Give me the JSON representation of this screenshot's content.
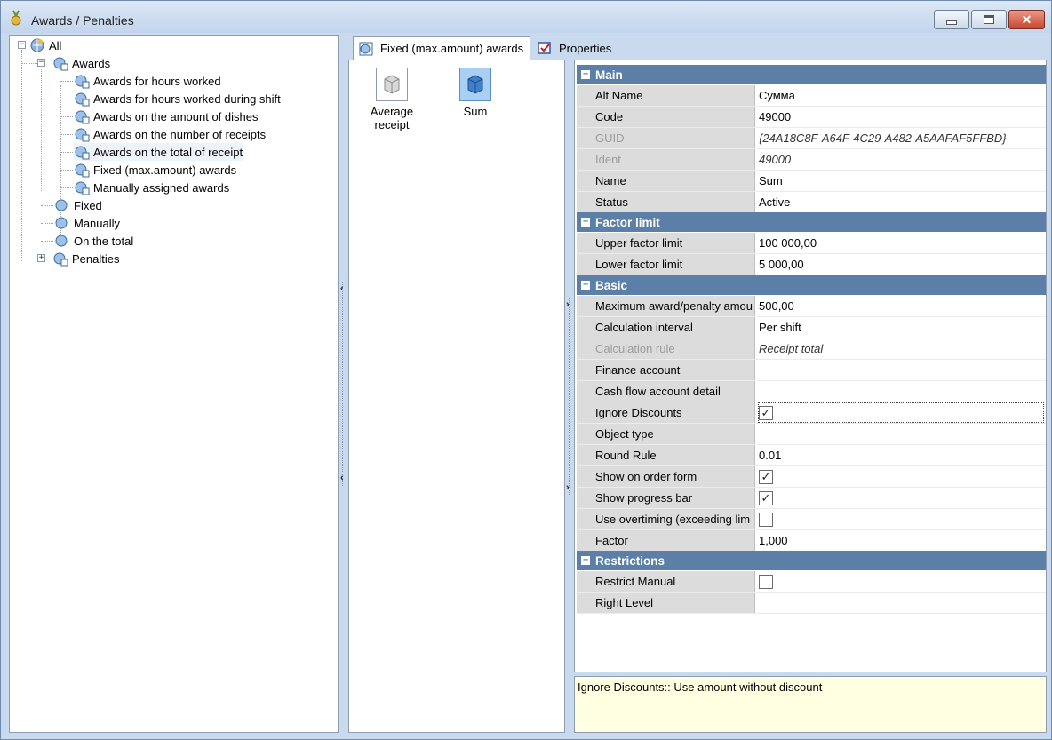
{
  "window": {
    "title": "Awards / Penalties"
  },
  "tree": {
    "root": "All",
    "awards": "Awards",
    "children": [
      "Awards for hours worked",
      "Awards for hours worked during shift",
      "Awards on the amount of dishes",
      "Awards on the number of receipts",
      "Awards on the total of receipt",
      "Fixed (max.amount) awards",
      "Manually assigned awards"
    ],
    "siblings": [
      "Fixed",
      "Manually",
      "On the total"
    ],
    "penalties": "Penalties"
  },
  "tabs": {
    "active": "Fixed (max.amount) awards",
    "properties": "Properties"
  },
  "items": [
    {
      "label": "Average receipt",
      "selected": false
    },
    {
      "label": "Sum",
      "selected": true
    }
  ],
  "properties": {
    "main": {
      "title": "Main",
      "rows": [
        {
          "name": "Alt Name",
          "value": "Сумма"
        },
        {
          "name": "Code",
          "value": "49000"
        },
        {
          "name": "GUID",
          "value": "{24A18C8F-A64F-4C29-A482-A5AAFAF5FFBD}"
        },
        {
          "name": "Ident",
          "value": "49000"
        },
        {
          "name": "Name",
          "value": "Sum"
        },
        {
          "name": "Status",
          "value": "Active"
        }
      ]
    },
    "factor": {
      "title": "Factor limit",
      "rows": [
        {
          "name": "Upper factor limit",
          "value": "100 000,00"
        },
        {
          "name": "Lower factor limit",
          "value": "5 000,00"
        }
      ]
    },
    "basic": {
      "title": "Basic",
      "rows": [
        {
          "name": "Maximum award/penalty amou",
          "value": "500,00"
        },
        {
          "name": "Calculation interval",
          "value": "Per shift"
        },
        {
          "name": "Calculation rule",
          "value": "Receipt total"
        },
        {
          "name": "Finance account",
          "value": ""
        },
        {
          "name": "Cash flow account detail",
          "value": ""
        },
        {
          "name": "Ignore Discounts",
          "value": "checked"
        },
        {
          "name": "Object type",
          "value": ""
        },
        {
          "name": "Round Rule",
          "value": "0.01"
        },
        {
          "name": "Show on order form",
          "value": "checked"
        },
        {
          "name": "Show progress bar",
          "value": "checked"
        },
        {
          "name": "Use overtiming (exceeding lim",
          "value": "unchecked"
        },
        {
          "name": "Factor",
          "value": "1,000"
        }
      ]
    },
    "restrictions": {
      "title": "Restrictions",
      "rows": [
        {
          "name": "Restrict Manual",
          "value": "unchecked"
        },
        {
          "name": "Right Level",
          "value": ""
        }
      ]
    }
  },
  "description": "Ignore Discounts:: Use amount without discount"
}
